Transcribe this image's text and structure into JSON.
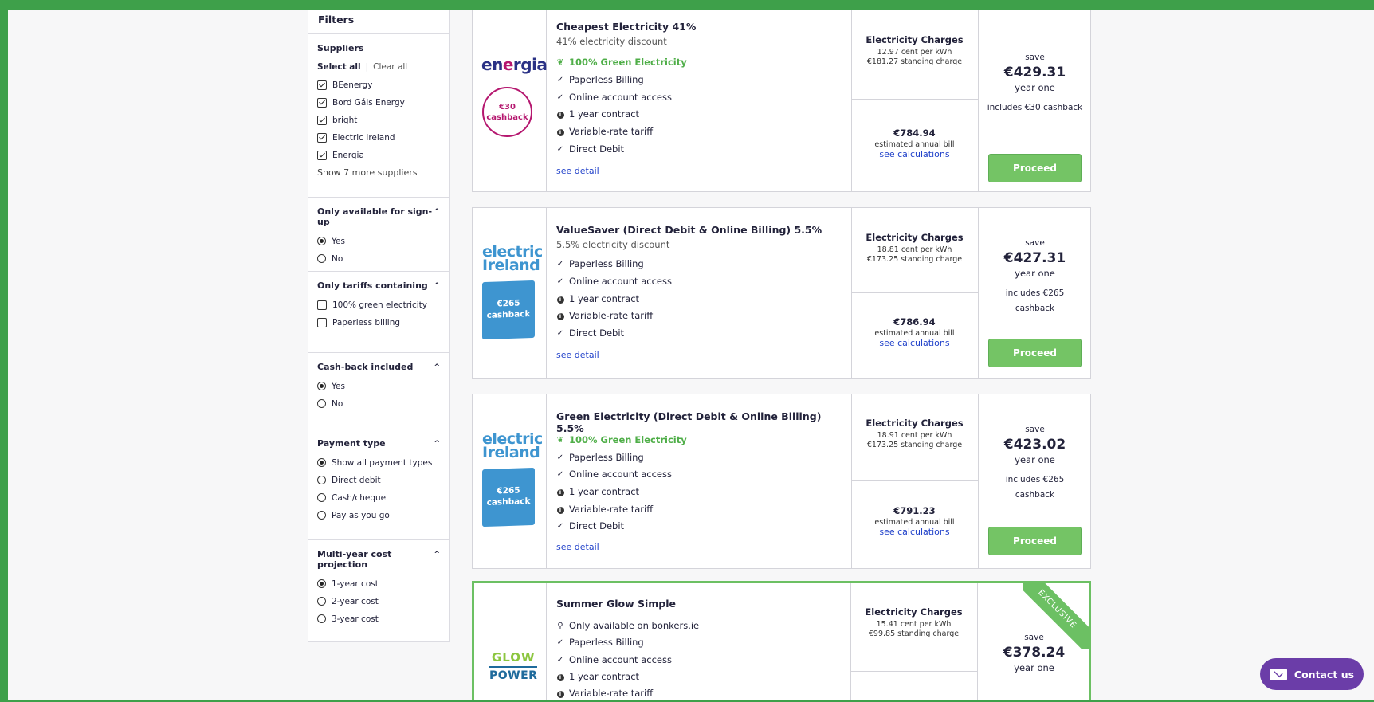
{
  "filters": {
    "title": "Filters",
    "suppliers": {
      "title": "Suppliers",
      "select_all": "Select all",
      "separator": "|",
      "clear_all": "Clear all",
      "items": [
        {
          "label": "BEenergy",
          "checked": true
        },
        {
          "label": "Bord Gáis Energy",
          "checked": true
        },
        {
          "label": "bright",
          "checked": true
        },
        {
          "label": "Electric Ireland",
          "checked": true
        },
        {
          "label": "Energia",
          "checked": true
        }
      ],
      "show_more": "Show 7 more suppliers"
    },
    "signup": {
      "title": "Only available for sign-up",
      "options": [
        {
          "label": "Yes",
          "selected": true
        },
        {
          "label": "No",
          "selected": false
        }
      ]
    },
    "tariffs": {
      "title": "Only tariffs containing",
      "options": [
        {
          "label": "100% green electricity",
          "checked": false
        },
        {
          "label": "Paperless billing",
          "checked": false
        }
      ]
    },
    "cashback": {
      "title": "Cash-back included",
      "options": [
        {
          "label": "Yes",
          "selected": true
        },
        {
          "label": "No",
          "selected": false
        }
      ]
    },
    "payment": {
      "title": "Payment type",
      "options": [
        {
          "label": "Show all payment types",
          "selected": true
        },
        {
          "label": "Direct debit",
          "selected": false
        },
        {
          "label": "Cash/cheque",
          "selected": false
        },
        {
          "label": "Pay as you go",
          "selected": false
        }
      ]
    },
    "projection": {
      "title": "Multi-year cost projection",
      "options": [
        {
          "label": "1-year cost",
          "selected": true
        },
        {
          "label": "2-year cost",
          "selected": false
        },
        {
          "label": "3-year cost",
          "selected": false
        }
      ]
    }
  },
  "cards": [
    {
      "logo": "energia",
      "cashback_badge": [
        "€30",
        "cashback"
      ],
      "name": "Cheapest Electricity 41%",
      "discount": "41% electricity discount",
      "features": [
        {
          "icon": "leaf-icon",
          "text": "100% Green Electricity",
          "green": true
        },
        {
          "icon": "check-icon",
          "text": "Paperless Billing"
        },
        {
          "icon": "check-icon",
          "text": "Online account access"
        },
        {
          "icon": "info-icon",
          "text": "1 year contract"
        },
        {
          "icon": "info-icon",
          "text": "Variable-rate tariff"
        },
        {
          "icon": "check-icon",
          "text": "Direct Debit"
        }
      ],
      "see_detail": "see detail",
      "charges_title": "Electricity Charges",
      "unit_rate": "12.97 cent per kWh",
      "standing": "€181.27 standing charge",
      "bill": "€784.94",
      "bill_label": "estimated annual bill",
      "calc": "see calculations",
      "save_label": "save",
      "save_amount": "€429.31",
      "save_period": "year one",
      "includes": "includes €30 cashback",
      "proceed": "Proceed"
    },
    {
      "logo": "electric-ireland",
      "logo_text": [
        "electric",
        "Ireland"
      ],
      "cashback_badge": [
        "€265",
        "cashback"
      ],
      "name": "ValueSaver (Direct Debit & Online Billing) 5.5%",
      "discount": "5.5% electricity discount",
      "features": [
        {
          "icon": "check-icon",
          "text": "Paperless Billing"
        },
        {
          "icon": "check-icon",
          "text": "Online account access"
        },
        {
          "icon": "info-icon",
          "text": "1 year contract"
        },
        {
          "icon": "info-icon",
          "text": "Variable-rate tariff"
        },
        {
          "icon": "check-icon",
          "text": "Direct Debit"
        }
      ],
      "see_detail": "see detail",
      "charges_title": "Electricity Charges",
      "unit_rate": "18.81 cent per kWh",
      "standing": "€173.25 standing charge",
      "bill": "€786.94",
      "bill_label": "estimated annual bill",
      "calc": "see calculations",
      "save_label": "save",
      "save_amount": "€427.31",
      "save_period": "year one",
      "includes": [
        "includes €265",
        "cashback"
      ],
      "proceed": "Proceed"
    },
    {
      "logo": "electric-ireland",
      "logo_text": [
        "electric",
        "Ireland"
      ],
      "cashback_badge": [
        "€265",
        "cashback"
      ],
      "name": "Green Electricity (Direct Debit & Online Billing) 5.5%",
      "features": [
        {
          "icon": "leaf-icon",
          "text": "100% Green Electricity",
          "green": true
        },
        {
          "icon": "check-icon",
          "text": "Paperless Billing"
        },
        {
          "icon": "check-icon",
          "text": "Online account access"
        },
        {
          "icon": "info-icon",
          "text": "1 year contract"
        },
        {
          "icon": "info-icon",
          "text": "Variable-rate tariff"
        },
        {
          "icon": "check-icon",
          "text": "Direct Debit"
        }
      ],
      "see_detail": "see detail",
      "charges_title": "Electricity Charges",
      "unit_rate": "18.91 cent per kWh",
      "standing": "€173.25 standing charge",
      "bill": "€791.23",
      "bill_label": "estimated annual bill",
      "calc": "see calculations",
      "save_label": "save",
      "save_amount": "€423.02",
      "save_period": "year one",
      "includes": [
        "includes €265",
        "cashback"
      ],
      "proceed": "Proceed"
    },
    {
      "logo": "glow-power",
      "logo_text": [
        "GLOW",
        "POWER"
      ],
      "ribbon": "EXCLUSIVE",
      "name": "Summer Glow Simple",
      "features": [
        {
          "icon": "search-icon",
          "text": "Only available on bonkers.ie"
        },
        {
          "icon": "check-icon",
          "text": "Paperless Billing"
        },
        {
          "icon": "check-icon",
          "text": "Online account access"
        },
        {
          "icon": "info-icon",
          "text": "1 year contract"
        },
        {
          "icon": "info-icon",
          "text": "Variable-rate tariff"
        }
      ],
      "charges_title": "Electricity Charges",
      "unit_rate": "15.41 cent per kWh",
      "standing": "€99.85 standing charge",
      "save_label": "save",
      "save_amount": "€378.24",
      "save_period": "year one"
    }
  ],
  "contact": {
    "label": "Contact us",
    "icon": "envelope-icon"
  },
  "colors": {
    "accent_green": "#74c465",
    "link_blue": "#1e3fc9",
    "frame_green": "#3ea04a",
    "contact_purple": "#6b3da8"
  }
}
